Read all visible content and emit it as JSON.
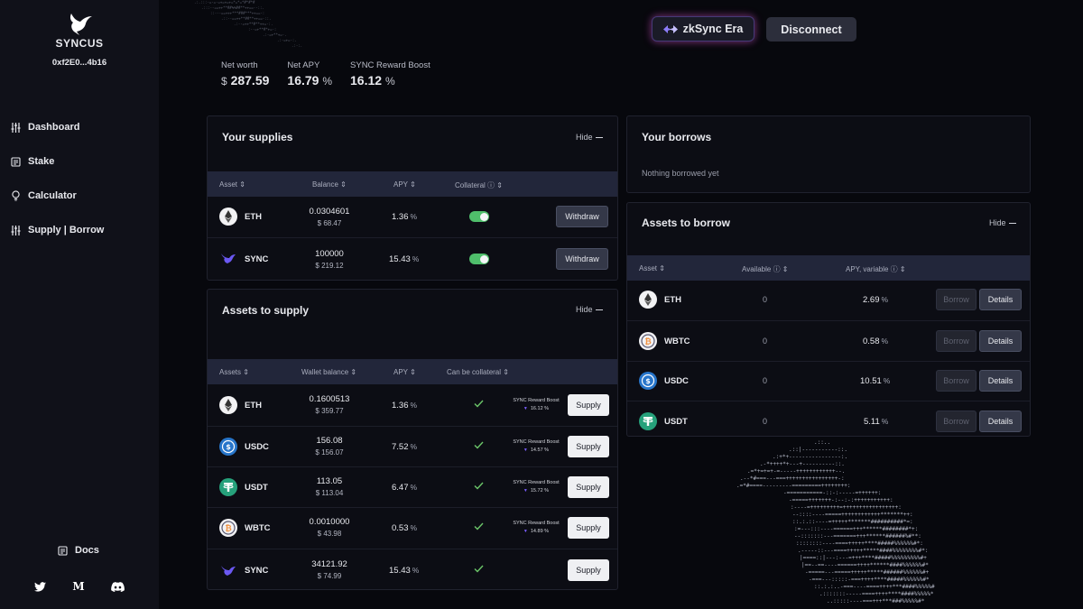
{
  "app": {
    "brand": "SYNCUS",
    "address": "0xf2E0...4b16"
  },
  "sidebar": {
    "items": [
      {
        "label": "Dashboard",
        "icon": "sliders-icon"
      },
      {
        "label": "Stake",
        "icon": "document-icon"
      },
      {
        "label": "Calculator",
        "icon": "lightbulb-icon"
      },
      {
        "label": "Supply | Borrow",
        "icon": "sliders-icon"
      }
    ],
    "docs_label": "Docs",
    "socials": [
      "twitter-icon",
      "medium-icon",
      "discord-icon"
    ]
  },
  "header": {
    "network_label": "zkSync Era",
    "disconnect_label": "Disconnect"
  },
  "stats": [
    {
      "label": "Net worth",
      "prefix": "$",
      "value": "287.59",
      "suffix": ""
    },
    {
      "label": "Net APY",
      "prefix": "",
      "value": "16.79",
      "suffix": "%"
    },
    {
      "label": "SYNC Reward Boost",
      "prefix": "",
      "value": "16.12",
      "suffix": "%"
    }
  ],
  "supplies": {
    "title": "Your supplies",
    "hide_label": "Hide",
    "columns": [
      "Asset",
      "Balance",
      "APY",
      "Collateral"
    ],
    "rows": [
      {
        "asset": "ETH",
        "balance": "0.0304601",
        "usd": "$ 68.47",
        "apy": "1.36",
        "collateral": true,
        "action": "Withdraw"
      },
      {
        "asset": "SYNC",
        "balance": "100000",
        "usd": "$ 219.12",
        "apy": "15.43",
        "collateral": true,
        "action": "Withdraw"
      }
    ]
  },
  "assets_to_supply": {
    "title": "Assets to supply",
    "hide_label": "Hide",
    "columns": [
      "Assets",
      "Wallet balance",
      "APY",
      "Can be collateral"
    ],
    "boost_label": "SYNC Reward Boost",
    "rows": [
      {
        "asset": "ETH",
        "balance": "0.1600513",
        "usd": "$ 359.77",
        "apy": "1.36",
        "collateral": true,
        "boost": "16.12",
        "action": "Supply"
      },
      {
        "asset": "USDC",
        "balance": "156.08",
        "usd": "$ 156.07",
        "apy": "7.52",
        "collateral": true,
        "boost": "14.57",
        "action": "Supply"
      },
      {
        "asset": "USDT",
        "balance": "113.05",
        "usd": "$ 113.04",
        "apy": "6.47",
        "collateral": true,
        "boost": "15.72",
        "action": "Supply"
      },
      {
        "asset": "WBTC",
        "balance": "0.0010000",
        "usd": "$ 43.98",
        "apy": "0.53",
        "collateral": true,
        "boost": "14.89",
        "action": "Supply"
      },
      {
        "asset": "SYNC",
        "balance": "34121.92",
        "usd": "$ 74.99",
        "apy": "15.43",
        "collateral": true,
        "boost": "",
        "action": "Supply"
      }
    ]
  },
  "borrows": {
    "title": "Your borrows",
    "empty_text": "Nothing borrowed yet"
  },
  "assets_to_borrow": {
    "title": "Assets to borrow",
    "hide_label": "Hide",
    "columns": [
      "Asset",
      "Available",
      "APY, variable"
    ],
    "rows": [
      {
        "asset": "ETH",
        "available": "0",
        "apy": "2.69",
        "borrow": "Borrow",
        "details": "Details"
      },
      {
        "asset": "WBTC",
        "available": "0",
        "apy": "0.58",
        "borrow": "Borrow",
        "details": "Details"
      },
      {
        "asset": "USDC",
        "available": "0",
        "apy": "10.51",
        "borrow": "Borrow",
        "details": "Details"
      },
      {
        "asset": "USDT",
        "available": "0",
        "apy": "5.11",
        "borrow": "Borrow",
        "details": "Details"
      }
    ]
  },
  "colors": {
    "accent": "#7b5fff",
    "toggle_on": "#4fbe6b",
    "check": "#6cc76a",
    "usdt": "#26a17b",
    "usdc": "#2775ca",
    "wbtc": "#f09242"
  }
}
